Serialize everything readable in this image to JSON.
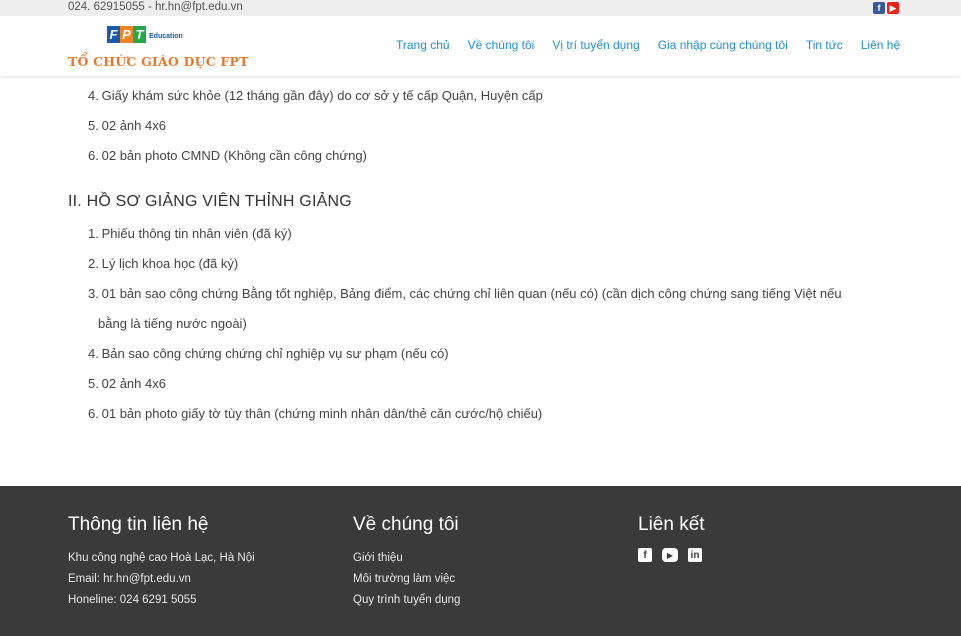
{
  "topbar": {
    "contact": "024. 62915055 - hr.hn@fpt.edu.vn",
    "icons": [
      "facebook-icon",
      "youtube-icon"
    ]
  },
  "logo": {
    "letters": [
      "F",
      "P",
      "T"
    ],
    "letter_colors": [
      "#1a5aa6",
      "#f08323",
      "#25a84a"
    ],
    "education": "Education",
    "org": "TỔ CHỨC GIÁO DỤC FPT"
  },
  "nav": {
    "items": [
      "Trang chủ",
      "Về chúng tôi",
      "Vị trí tuyển dụng",
      "Gia nhập cùng chúng tôi",
      "Tin tức",
      "Liên hệ"
    ]
  },
  "content": {
    "list1": [
      {
        "num": "4.",
        "text": "Giấy khám sức khỏe (12 tháng gần đây) do cơ sở y tế cấp Quận, Huyện cấp"
      },
      {
        "num": "5.",
        "text": "02 ảnh 4x6"
      },
      {
        "num": "6.",
        "text": "02 bản photo CMND (Không cần công chứng)"
      }
    ],
    "section_title": "II. HỒ SƠ GIẢNG VIÊN THỈNH GIẢNG",
    "list2": [
      {
        "num": "1.",
        "text": "Phiếu thông tin nhân viên (đã ký)"
      },
      {
        "num": "2.",
        "text": "Lý lịch khoa học (đã ký)"
      },
      {
        "num": "3.",
        "text": "01 bản sao công chứng Bằng tốt nghiệp, Bảng điểm, các chứng chỉ liên quan (nếu có) (cần dịch công chứng sang tiếng Việt nếu",
        "text2": "bằng là tiếng nước ngoài)"
      },
      {
        "num": "4.",
        "text": "Bản sao công chứng chứng chỉ nghiệp vụ sư phạm (nếu có)"
      },
      {
        "num": "5.",
        "text": "02 ảnh 4x6"
      },
      {
        "num": "6.",
        "text": "01 bản photo giấy tờ tùy thân (chứng minh nhân dân/thẻ căn cước/hộ chiếu)"
      }
    ]
  },
  "footer": {
    "contact": {
      "title": "Thông tin liên hệ",
      "lines": [
        "Khu công nghệ cao Hoà Lạc, Hà Nội",
        "Email: hr.hn@fpt.edu.vn",
        "Honeline: 024 6291 5055"
      ]
    },
    "about": {
      "title": "Về chúng tôi",
      "links": [
        "Giới thiệu",
        "Môi trường làm việc",
        "Quy trình tuyển dụng"
      ]
    },
    "links": {
      "title": "Liên kết",
      "icons": [
        "facebook-icon",
        "youtube-icon",
        "linkedin-icon"
      ]
    }
  }
}
